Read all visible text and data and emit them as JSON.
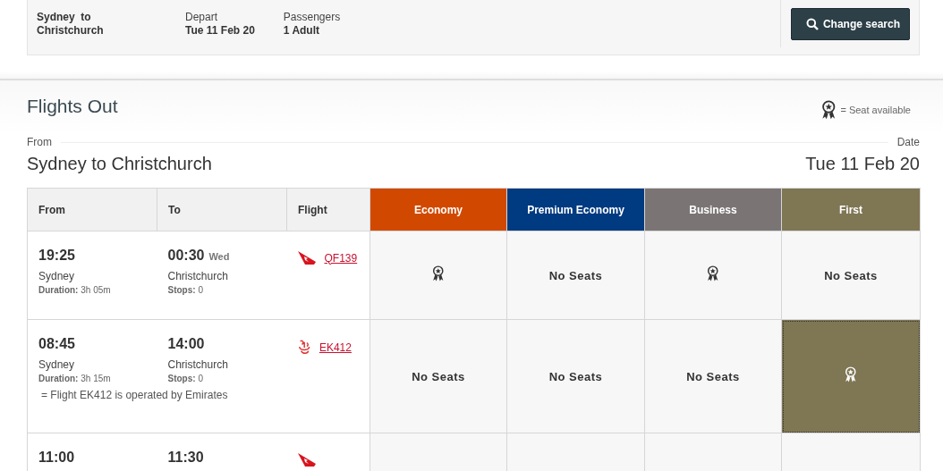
{
  "summary": {
    "route": "Sydney  to Christchurch",
    "fields": [
      {
        "label": "Depart",
        "value": "Tue 11 Feb 20"
      },
      {
        "label": "Passengers",
        "value": "1 Adult"
      }
    ],
    "button": "Change search"
  },
  "section": {
    "title": "Flights Out",
    "legend": "= Seat available",
    "from_label": "From",
    "date_label": "Date",
    "route": "Sydney to Christchurch",
    "date": "Tue 11 Feb 20"
  },
  "table": {
    "columns": [
      "From",
      "To",
      "Flight"
    ],
    "cabins": [
      {
        "name": "Economy",
        "color": "#d14900"
      },
      {
        "name": "Premium Economy",
        "color": "#003a80"
      },
      {
        "name": "Business",
        "color": "#7a7574"
      },
      {
        "name": "First",
        "color": "#7f7654"
      }
    ],
    "rows": [
      {
        "depart": "19:25",
        "from": "Sydney",
        "duration_label": "Duration:",
        "duration": "3h 05m",
        "arrive": "00:30",
        "arrive_day": "Wed",
        "to": "Christchurch",
        "stops_label": "Stops:",
        "stops": "0",
        "kind": "tail",
        "flight": "QF139",
        "cells": [
          {
            "kind": "available",
            "selected": false
          },
          {
            "kind": "none",
            "text": "No Seats",
            "selected": false
          },
          {
            "kind": "available",
            "selected": false
          },
          {
            "kind": "none",
            "text": "No Seats",
            "selected": false
          }
        ]
      },
      {
        "depart": "08:45",
        "from": "Sydney",
        "duration_label": "Duration:",
        "duration": "3h 15m",
        "arrive": "14:00",
        "to": "Christchurch",
        "stops_label": "Stops:",
        "stops": "0",
        "kind": "calligraphy",
        "flight": "EK412",
        "note": "= Flight EK412 is operated by Emirates",
        "cells": [
          {
            "kind": "none",
            "text": "No Seats",
            "selected": false
          },
          {
            "kind": "none",
            "text": "No Seats",
            "selected": false
          },
          {
            "kind": "none",
            "text": "No Seats",
            "selected": false
          },
          {
            "kind": "available",
            "selected": true
          }
        ]
      },
      {
        "depart": "11:00",
        "arrive": "11:30",
        "kind": "tail",
        "cells": [
          {
            "kind": "none",
            "selected": false
          },
          {
            "kind": "none",
            "selected": false
          },
          {
            "kind": "none",
            "selected": false
          },
          {
            "kind": "none",
            "selected": false
          }
        ]
      }
    ]
  }
}
